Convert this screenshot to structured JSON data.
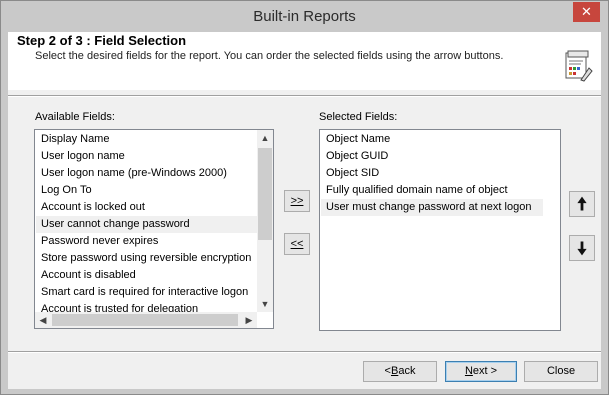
{
  "window": {
    "title": "Built-in Reports",
    "close_glyph": "✕"
  },
  "header": {
    "title": "Step 2 of 3  : Field Selection",
    "description": "Select the desired fields for the report. You can order the selected fields using the arrow buttons.",
    "icon": "report-icon"
  },
  "available": {
    "label": "Available Fields:",
    "items": [
      "Display Name",
      "User logon name",
      "User logon name (pre-Windows 2000)",
      "Log On To",
      "Account is locked out",
      "User cannot change password",
      "Password never expires",
      "Store password using reversible encryption",
      "Account is disabled",
      "Smart card is required for interactive logon",
      "Account is trusted for delegation"
    ],
    "selected_item": "User cannot change password"
  },
  "selected": {
    "label": "Selected Fields:",
    "items": [
      "Object Name",
      "Object GUID",
      "Object SID",
      "Fully qualified domain name of object",
      "User must change password at next logon"
    ],
    "selected_item": "User must change password at next logon"
  },
  "transfer": {
    "add_label": ">>",
    "remove_label": "<<"
  },
  "order": {
    "up_glyph": "🡅",
    "down_glyph": "🡇"
  },
  "footer": {
    "back_mnemonic": "B",
    "back_rest": "ack",
    "back_prefix": "<",
    "next_mnemonic": "N",
    "next_rest": "ext >",
    "close_label": "Close"
  },
  "colors": {
    "close_button": "#c7463d",
    "selection": "#f0f0f0",
    "default_button_border": "#3c7fb1"
  }
}
